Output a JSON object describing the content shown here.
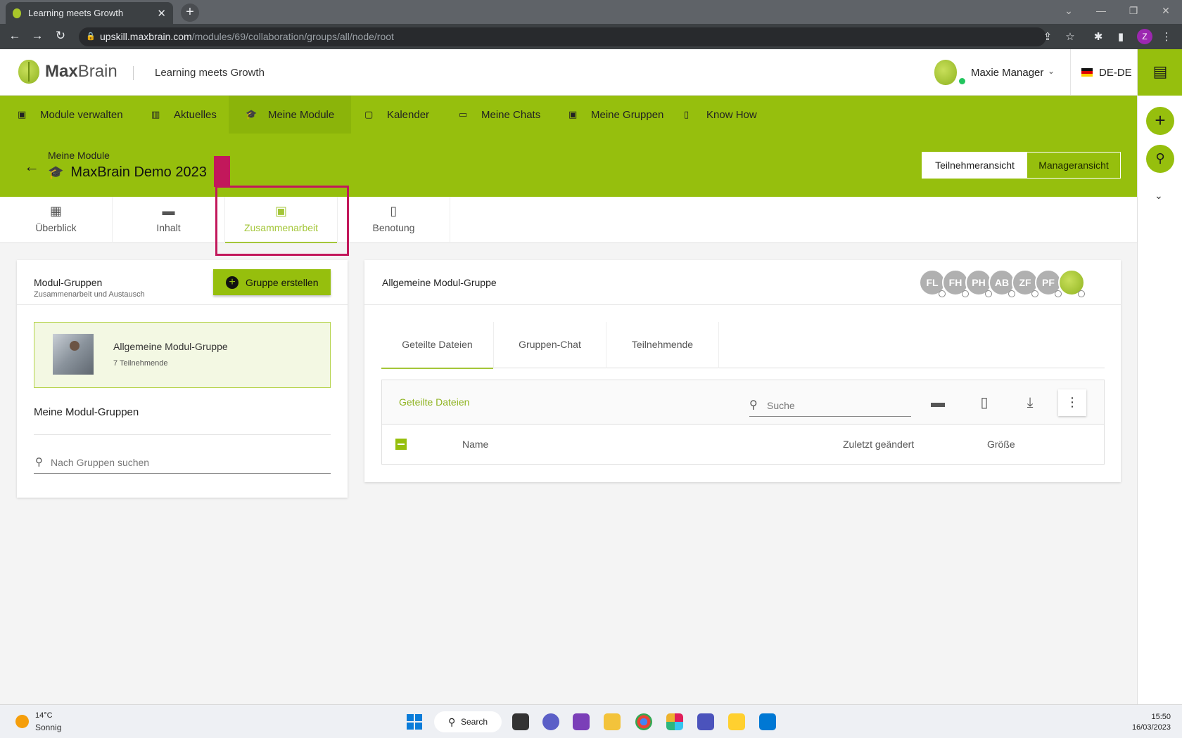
{
  "browser": {
    "tab_title": "Learning meets Growth",
    "url_host": "upskill.maxbrain.com",
    "url_path": "/modules/69/collaboration/groups/all/node/root",
    "profile_initial": "Z"
  },
  "header": {
    "logo_max": "Max",
    "logo_brain": "Brain",
    "tagline": "Learning meets Growth",
    "user_name": "Maxie Manager",
    "language": "DE-DE"
  },
  "nav": {
    "items": [
      {
        "label": "Module verwalten"
      },
      {
        "label": "Aktuelles"
      },
      {
        "label": "Meine Module"
      },
      {
        "label": "Kalender"
      },
      {
        "label": "Meine Chats"
      },
      {
        "label": "Meine Gruppen"
      },
      {
        "label": "Know How"
      }
    ]
  },
  "module": {
    "breadcrumb": "Meine Module",
    "title": "MaxBrain Demo 2023",
    "view_participant": "Teilnehmeransicht",
    "view_manager": "Manageransicht"
  },
  "section_tabs": [
    {
      "label": "Überblick"
    },
    {
      "label": "Inhalt"
    },
    {
      "label": "Zusammenarbeit"
    },
    {
      "label": "Benotung"
    }
  ],
  "groups_panel": {
    "title": "Modul-Gruppen",
    "subtitle": "Zusammenarbeit und Austausch",
    "create_button": "Gruppe erstellen",
    "group_name": "Allgemeine Modul-Gruppe",
    "group_count": "7 Teilnehmende",
    "my_groups_title": "Meine Modul-Gruppen",
    "search_placeholder": "Nach Gruppen suchen"
  },
  "group_detail": {
    "title": "Allgemeine Modul-Gruppe",
    "members": [
      "FL",
      "FH",
      "PH",
      "AB",
      "ZF",
      "PF"
    ],
    "tabs": [
      {
        "label": "Geteilte Dateien"
      },
      {
        "label": "Gruppen-Chat"
      },
      {
        "label": "Teilnehmende"
      }
    ],
    "files_title": "Geteilte Dateien",
    "search_placeholder": "Suche",
    "col_name": "Name",
    "col_modified": "Zuletzt geändert",
    "col_size": "Größe"
  },
  "taskbar": {
    "temperature": "14°C",
    "weather": "Sonnig",
    "search_label": "Search",
    "time": "15:50",
    "date": "16/03/2023"
  },
  "colors": {
    "brand_green": "#96bf0d",
    "highlight_magenta": "#c2185b"
  }
}
